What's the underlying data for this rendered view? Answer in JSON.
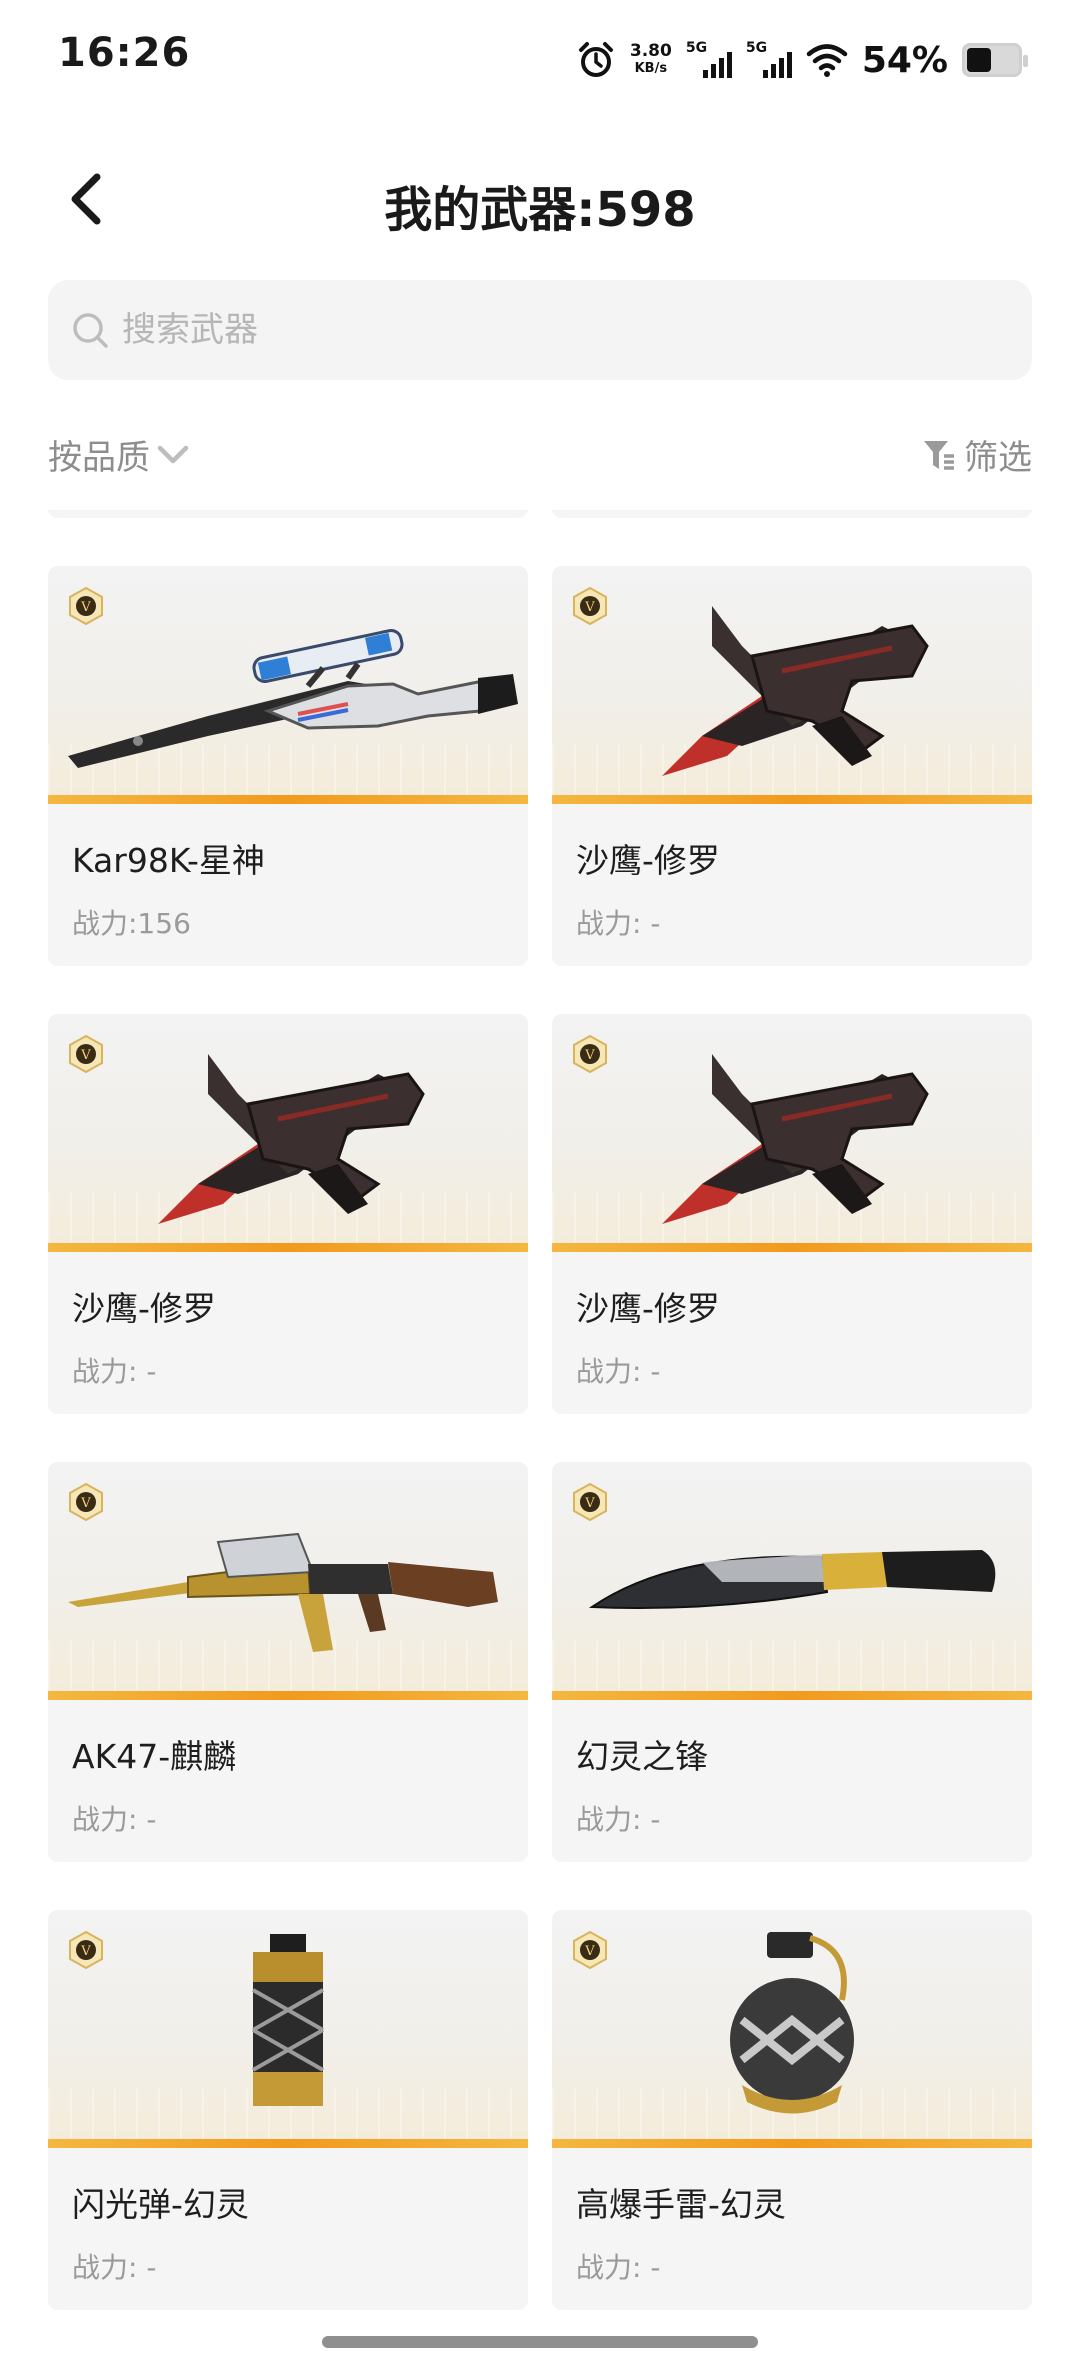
{
  "status_bar": {
    "time": "16:26",
    "net_speed_value": "3.80",
    "net_speed_unit": "KB/s",
    "sim1": "5G",
    "sim2": "5G",
    "battery_percent": "54%",
    "battery_level": 0.54,
    "icons": [
      "alarm-icon",
      "signal-icon",
      "wifi-icon",
      "battery-icon"
    ]
  },
  "header": {
    "title": "我的武器:598",
    "back_icon": "chevron-left-icon"
  },
  "search": {
    "placeholder": "搜索武器",
    "value": ""
  },
  "filters": {
    "sort_label": "按品质",
    "filter_label": "筛选"
  },
  "colors": {
    "accent_stripe": "#f29a1d",
    "card_bg": "#f5f5f5",
    "search_bg": "#f4f4f4",
    "muted_text": "#8d8d8d"
  },
  "weapons": [
    {
      "name": "Kar98K-星神",
      "power": "战力:156",
      "icon": "sniper-rifle-icon"
    },
    {
      "name": "沙鹰-修罗",
      "power": "战力: -",
      "icon": "pistol-blade-icon"
    },
    {
      "name": "沙鹰-修罗",
      "power": "战力: -",
      "icon": "pistol-blade-icon"
    },
    {
      "name": "沙鹰-修罗",
      "power": "战力: -",
      "icon": "pistol-blade-icon"
    },
    {
      "name": "AK47-麒麟",
      "power": "战力: -",
      "icon": "assault-rifle-icon"
    },
    {
      "name": "幻灵之锋",
      "power": "战力: -",
      "icon": "machete-icon"
    },
    {
      "name": "闪光弹-幻灵",
      "power": "战力: -",
      "icon": "flashbang-icon"
    },
    {
      "name": "高爆手雷-幻灵",
      "power": "战力: -",
      "icon": "grenade-icon"
    }
  ]
}
